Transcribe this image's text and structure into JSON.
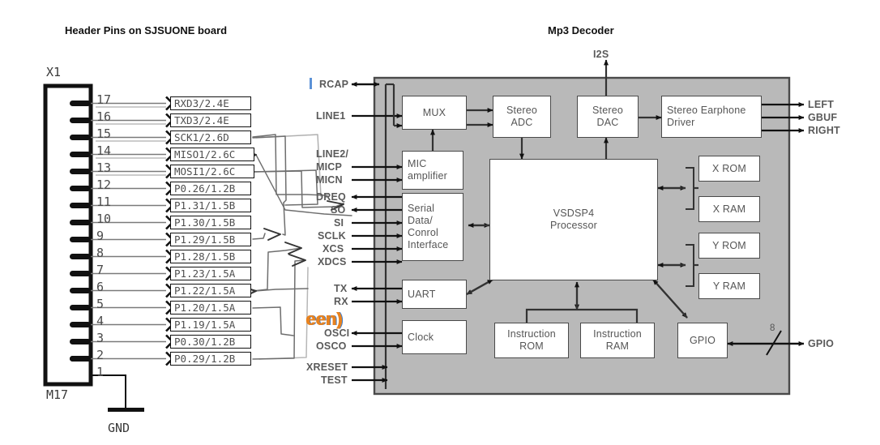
{
  "titles": {
    "left": "Header Pins on SJSUONE board",
    "right": "Mp3 Decoder"
  },
  "connector": {
    "refdes_top": "X1",
    "refdes_bottom": "M17",
    "ground_label": "GND",
    "pins": [
      {
        "num": "17",
        "net": "RXD3/2.4E"
      },
      {
        "num": "16",
        "net": "TXD3/2.4E"
      },
      {
        "num": "15",
        "net": "SCK1/2.6D"
      },
      {
        "num": "14",
        "net": "MISO1/2.6C"
      },
      {
        "num": "13",
        "net": "MOSI1/2.6C"
      },
      {
        "num": "12",
        "net": "P0.26/1.2B"
      },
      {
        "num": "11",
        "net": "P1.31/1.5B"
      },
      {
        "num": "10",
        "net": "P1.30/1.5B"
      },
      {
        "num": "9",
        "net": "P1.29/1.5B"
      },
      {
        "num": "8",
        "net": "P1.28/1.5B"
      },
      {
        "num": "7",
        "net": "P1.23/1.5A"
      },
      {
        "num": "6",
        "net": "P1.22/1.5A"
      },
      {
        "num": "5",
        "net": "P1.20/1.5A"
      },
      {
        "num": "4",
        "net": "P1.19/1.5A"
      },
      {
        "num": "3",
        "net": "P0.30/1.2B"
      },
      {
        "num": "2",
        "net": "P0.29/1.2B"
      },
      {
        "num": "1",
        "net": ""
      }
    ]
  },
  "decoder": {
    "left_pins": [
      {
        "label": "RCAP",
        "dir": "bidir"
      },
      {
        "label": "LINE1",
        "dir": "in"
      },
      {
        "label": "LINE2/",
        "dir": "none"
      },
      {
        "label": "MICP",
        "dir": "in"
      },
      {
        "label": "MICN",
        "dir": "in"
      },
      {
        "label": "DREQ",
        "dir": "out"
      },
      {
        "label": "SO",
        "dir": "out"
      },
      {
        "label": "SI",
        "dir": "in"
      },
      {
        "label": "SCLK",
        "dir": "in"
      },
      {
        "label": "XCS",
        "dir": "in"
      },
      {
        "label": "XDCS",
        "dir": "in"
      },
      {
        "label": "TX",
        "dir": "out"
      },
      {
        "label": "RX",
        "dir": "in"
      },
      {
        "label": "OSCI",
        "dir": "out"
      },
      {
        "label": "OSCO",
        "dir": "in"
      },
      {
        "label": "XRESET",
        "dir": "in"
      },
      {
        "label": "TEST",
        "dir": "in"
      }
    ],
    "right_pins": [
      "LEFT",
      "GBUF",
      "RIGHT",
      "GPIO"
    ],
    "top_pin": "I2S",
    "bus_width": "8",
    "blocks": [
      {
        "id": "mux",
        "label": "MUX"
      },
      {
        "id": "adc",
        "label": "Stereo\nADC"
      },
      {
        "id": "dac",
        "label": "Stereo\nDAC"
      },
      {
        "id": "eardrv",
        "label": "Stereo Earphone\nDriver"
      },
      {
        "id": "mic",
        "label": "MIC\namplifier"
      },
      {
        "id": "serial",
        "label": "Serial\nData/\nConrol\nInterface"
      },
      {
        "id": "dsp",
        "label": "VSDSP4\nProcessor"
      },
      {
        "id": "xrom",
        "label": "X ROM"
      },
      {
        "id": "xram",
        "label": "X RAM"
      },
      {
        "id": "yrom",
        "label": "Y ROM"
      },
      {
        "id": "yram",
        "label": "Y RAM"
      },
      {
        "id": "uart",
        "label": "UART"
      },
      {
        "id": "clock",
        "label": "Clock"
      },
      {
        "id": "irom",
        "label": "Instruction\nROM"
      },
      {
        "id": "iram",
        "label": "Instruction\nRAM"
      },
      {
        "id": "gpio",
        "label": "GPIO"
      }
    ]
  },
  "artifacts": {
    "clipped_text": "een)"
  },
  "colors": {
    "chip_fill": "#b9b9b9",
    "block_stroke": "#4a4a4a",
    "text_gray": "#555555",
    "ink": "#111111",
    "clip_orange": "#e8821e",
    "clip_blue": "#3f7fd0"
  }
}
